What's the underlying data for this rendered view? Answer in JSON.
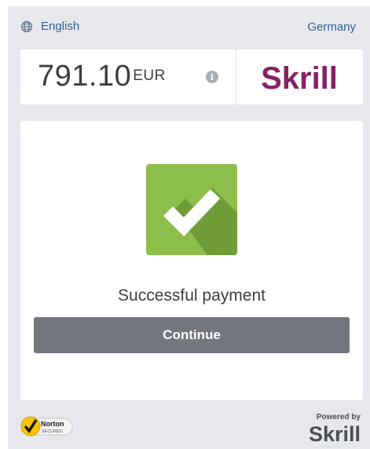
{
  "header": {
    "language_icon": "globe-icon",
    "language_label": "English",
    "country_label": "Germany"
  },
  "amount": {
    "value": "791.10",
    "currency": "EUR",
    "info_icon": "info-icon",
    "info_glyph": "i"
  },
  "brand": {
    "logo_text": "Skrill",
    "color": "#862165"
  },
  "status": {
    "icon": "checkmark-icon",
    "message": "Successful payment",
    "success_color": "#8dbd4a"
  },
  "actions": {
    "continue_label": "Continue",
    "button_color": "#72767f"
  },
  "footer": {
    "norton_badge_text": "Norton",
    "norton_badge_subtext": "SECURED",
    "powered_by_text": "Powered by",
    "powered_brand": "Skrill"
  }
}
